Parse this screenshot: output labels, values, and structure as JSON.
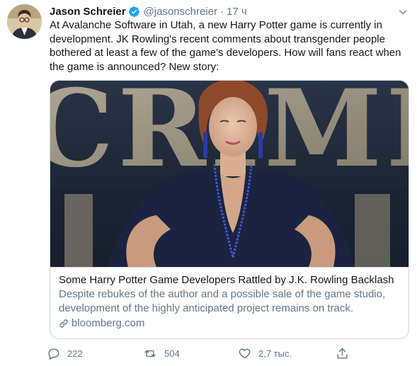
{
  "author": {
    "name": "Jason Schreier",
    "handle": "@jasonschreier",
    "separator": "·",
    "time": "17 ч",
    "verified": true
  },
  "tweet": {
    "text": "At Avalanche Software in Utah, a new Harry Potter game is currently in development. JK Rowling's recent comments about transgender people bothered at least a few of the game's developers. How will fans react when the game is announced? New story:"
  },
  "card": {
    "title": "Some Harry Potter Game Developers Rattled by J.K. Rowling Backlash",
    "description": "Despite rebukes of the author and a possible sale of the game studio, development of the highly anticipated project remains on track.",
    "domain": "bloomberg.com",
    "image_background_text": "CRIMI"
  },
  "actions": {
    "replies": "222",
    "retweets": "504",
    "likes": "2,7 тыс."
  },
  "icons": {
    "verified": "verified-badge-icon",
    "caret": "chevron-down-icon",
    "link": "link-icon",
    "reply": "reply-icon",
    "retweet": "retweet-icon",
    "like": "heart-icon",
    "share": "share-icon"
  },
  "colors": {
    "accent": "#1da1f2",
    "secondary_text": "#657786",
    "border": "#ccd6dd",
    "primary_text": "#14171a"
  }
}
